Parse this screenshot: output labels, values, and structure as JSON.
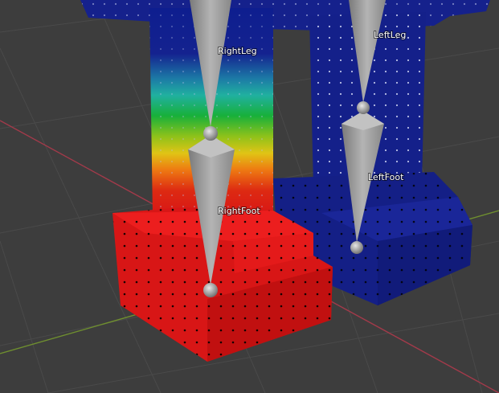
{
  "viewport": {
    "background_color": "#3d3d3d",
    "grid_color": "#4a4a4a",
    "x_axis_color": "#a33a4a",
    "y_axis_color": "#6f8f2f"
  },
  "colors": {
    "left_mesh": "#15218c",
    "weight_min": "#0e1e8f",
    "weight_max": "#dd1212",
    "bone": "#9a9a9a",
    "vertex": "#000000"
  },
  "bones": [
    {
      "name": "RightLeg",
      "label": "RightLeg",
      "selected": false
    },
    {
      "name": "LeftLeg",
      "label": "LeftLeg",
      "selected": false
    },
    {
      "name": "RightFoot",
      "label": "RightFoot",
      "selected": true
    },
    {
      "name": "LeftFoot",
      "label": "LeftFoot",
      "selected": false
    }
  ]
}
